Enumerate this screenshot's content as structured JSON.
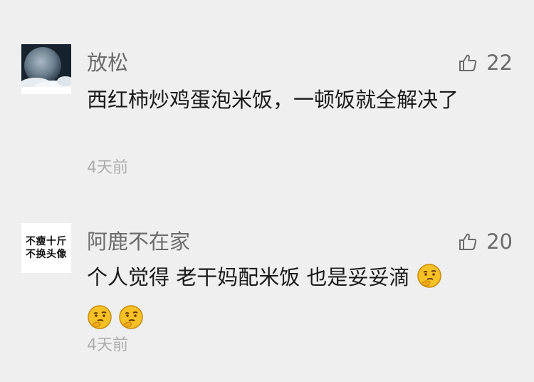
{
  "comments": [
    {
      "username": "放松",
      "likes": "22",
      "text": "西红柿炒鸡蛋泡米饭，一顿饭就全解决了",
      "time": "4天前",
      "avatar_icon": "moon-clouds-avatar"
    },
    {
      "username": "阿鹿不在家",
      "likes": "20",
      "text": "个人觉得 老干妈配米饭 也是妥妥滴",
      "time": "4天前",
      "avatar_lines": [
        "不瘦十斤",
        "不换头像"
      ],
      "emoji_icon": "thinking-face-emoji"
    }
  ],
  "colors": {
    "background": "#efefef",
    "username": "#6b6b6b",
    "content": "#1a1a1a",
    "timestamp": "#adadad",
    "emoji": "#f5c125"
  }
}
